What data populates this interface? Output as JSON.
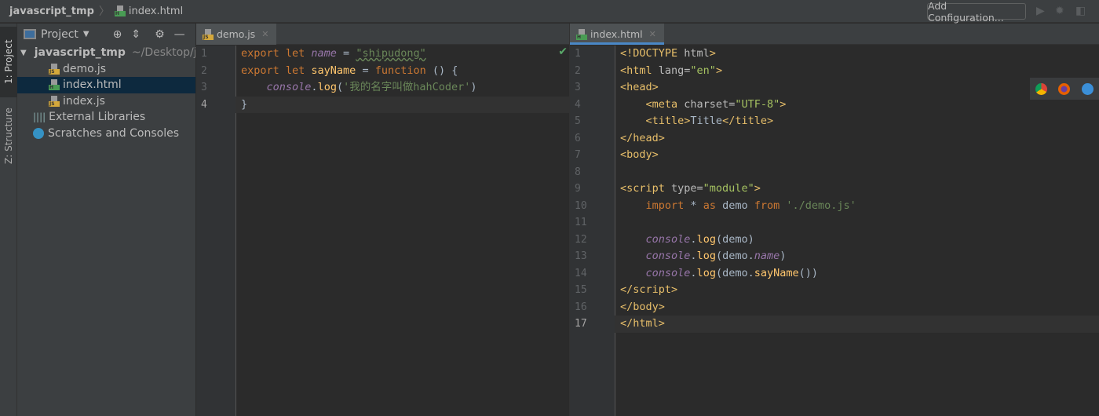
{
  "breadcrumb": {
    "project": "javascript_tmp",
    "file": "index.html"
  },
  "toolbar": {
    "add_configuration": "Add Configuration...",
    "run_icon": "play-icon",
    "debug_icon": "bug-icon",
    "coverage_icon": "coverage-icon"
  },
  "side_strip": {
    "project_tab": "1: Project",
    "structure_tab": "Z: Structure"
  },
  "project_panel": {
    "title": "Project",
    "root": {
      "name": "javascript_tmp",
      "path": "~/Desktop/javascript_tmp"
    },
    "files": [
      {
        "name": "demo.js",
        "type": "js"
      },
      {
        "name": "index.html",
        "type": "html",
        "selected": true
      },
      {
        "name": "index.js",
        "type": "js"
      }
    ],
    "external": "External Libraries",
    "scratches": "Scratches and Consoles"
  },
  "left_editor": {
    "tab": "demo.js",
    "lines": [
      [
        [
          "k",
          "export let "
        ],
        [
          "pi",
          "name"
        ],
        [
          "p",
          " = "
        ],
        [
          "sw",
          "\"shipudong\""
        ]
      ],
      [
        [
          "k",
          "export let "
        ],
        [
          "f",
          "sayName"
        ],
        [
          "p",
          " = "
        ],
        [
          "k",
          "function "
        ],
        [
          "p",
          "() {"
        ]
      ],
      [
        [
          "p",
          "    "
        ],
        [
          "ci",
          "console"
        ],
        [
          "p",
          "."
        ],
        [
          "f2",
          "log"
        ],
        [
          "p",
          "("
        ],
        [
          "s",
          "'我的名字叫做hahCoder'"
        ],
        [
          "p",
          ")"
        ]
      ],
      [
        [
          "p",
          "}"
        ]
      ]
    ],
    "current_line": 4
  },
  "right_editor": {
    "tab": "index.html",
    "lines": [
      [
        [
          "t",
          "<!DOCTYPE "
        ],
        [
          "a",
          "html"
        ],
        [
          "t",
          ">"
        ]
      ],
      [
        [
          "t",
          "<html "
        ],
        [
          "a",
          "lang="
        ],
        [
          "v",
          "\"en\""
        ],
        [
          "t",
          ">"
        ]
      ],
      [
        [
          "t",
          "<head>"
        ]
      ],
      [
        [
          "p",
          "    "
        ],
        [
          "t",
          "<meta "
        ],
        [
          "a",
          "charset="
        ],
        [
          "v",
          "\"UTF-8\""
        ],
        [
          "t",
          ">"
        ]
      ],
      [
        [
          "p",
          "    "
        ],
        [
          "t",
          "<title>"
        ],
        [
          "p",
          "Title"
        ],
        [
          "t",
          "</title>"
        ]
      ],
      [
        [
          "t",
          "</head>"
        ]
      ],
      [
        [
          "t",
          "<body>"
        ]
      ],
      [],
      [
        [
          "t",
          "<script "
        ],
        [
          "a",
          "type="
        ],
        [
          "v",
          "\"module\""
        ],
        [
          "t",
          ">"
        ]
      ],
      [
        [
          "p",
          "    "
        ],
        [
          "k",
          "import "
        ],
        [
          "p",
          "* "
        ],
        [
          "k",
          "as "
        ],
        [
          "p",
          "demo "
        ],
        [
          "k",
          "from "
        ],
        [
          "s",
          "'./demo.js'"
        ]
      ],
      [],
      [
        [
          "p",
          "    "
        ],
        [
          "ci",
          "console"
        ],
        [
          "p",
          "."
        ],
        [
          "f2",
          "log"
        ],
        [
          "p",
          "(demo)"
        ]
      ],
      [
        [
          "p",
          "    "
        ],
        [
          "ci",
          "console"
        ],
        [
          "p",
          "."
        ],
        [
          "f2",
          "log"
        ],
        [
          "p",
          "(demo."
        ],
        [
          "pv",
          "name"
        ],
        [
          "p",
          ")"
        ]
      ],
      [
        [
          "p",
          "    "
        ],
        [
          "ci",
          "console"
        ],
        [
          "p",
          "."
        ],
        [
          "f2",
          "log"
        ],
        [
          "p",
          "(demo."
        ],
        [
          "f2",
          "sayName"
        ],
        [
          "p",
          "())"
        ]
      ],
      [
        [
          "t",
          "</script>"
        ]
      ],
      [
        [
          "t",
          "</body>"
        ]
      ],
      [
        [
          "t",
          "</html>"
        ]
      ]
    ],
    "current_line": 17
  },
  "colors": {
    "accent": "#4a88c7",
    "selection": "#0d293e"
  }
}
